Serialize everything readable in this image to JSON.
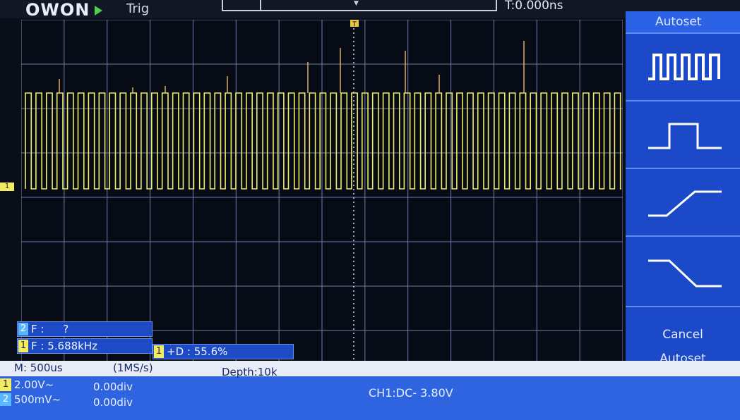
{
  "header": {
    "brand": "OWON",
    "run_state_icon": "play-icon",
    "trigger_label": "Trig",
    "time_offset": "T:0.000ns"
  },
  "menu": {
    "title": "Autoset",
    "items": [
      {
        "icon": "multi-pulse-wave-icon"
      },
      {
        "icon": "single-pulse-icon"
      },
      {
        "icon": "rising-edge-icon"
      },
      {
        "icon": "falling-edge-icon"
      }
    ],
    "cancel_line1": "Cancel",
    "cancel_line2": "Autoset"
  },
  "measurements": {
    "ch2_freq_label": "F :",
    "ch2_freq_value": "?",
    "ch1_freq_label": "F : 5.688kHz",
    "ch1_duty_label": "+D : 55.6%",
    "ch1_num": "1",
    "ch2_num": "2"
  },
  "status": {
    "timebase": "M: 500us",
    "sample_rate": "(1MS/s)",
    "depth": "Depth:10k",
    "ch1_scale": "2.00V~",
    "ch1_offset": "0.00div",
    "ch2_scale": "500mV~",
    "ch2_offset": "0.00div",
    "trigger_info": "CH1:DC-  3.80V"
  },
  "colors": {
    "ch1": "#f1ec62",
    "grid": "#6f7fae",
    "menu": "#1f4fd0"
  }
}
